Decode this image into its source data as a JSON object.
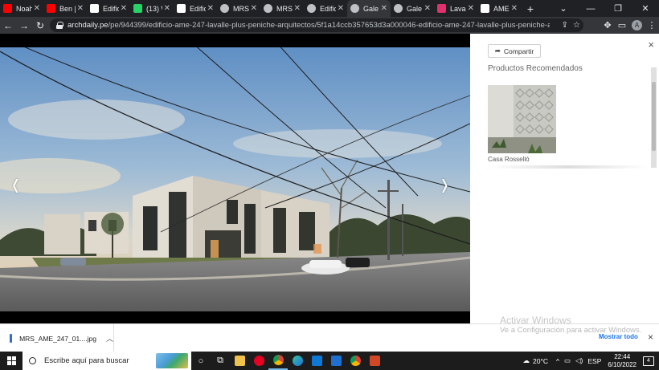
{
  "tabs": [
    {
      "title": "Noah",
      "icon": "youtube-icon",
      "color": "#ff0000"
    },
    {
      "title": "Ben |",
      "icon": "youtube-icon",
      "color": "#ff0000"
    },
    {
      "title": "Edific",
      "icon": "archdaily-icon",
      "color": "#ffffff"
    },
    {
      "title": "(13) W",
      "icon": "whatsapp-icon",
      "color": "#25d366"
    },
    {
      "title": "Edific",
      "icon": "archdaily-icon",
      "color": "#ffffff"
    },
    {
      "title": "MRS",
      "icon": "globe-icon",
      "color": "#bdc1c6"
    },
    {
      "title": "MRS",
      "icon": "globe-icon",
      "color": "#bdc1c6"
    },
    {
      "title": "Edific",
      "icon": "loading-icon",
      "color": "#bdc1c6"
    },
    {
      "title": "Gale",
      "icon": "globe-icon",
      "color": "#bdc1c6",
      "active": true
    },
    {
      "title": "Gale",
      "icon": "globe-icon",
      "color": "#bdc1c6"
    },
    {
      "title": "Lava",
      "icon": "instagram-icon",
      "color": "#e1306c"
    },
    {
      "title": "AME",
      "icon": "archdaily-icon",
      "color": "#ffffff"
    }
  ],
  "browser": {
    "url_host": "archdaily.pe",
    "url_path": "/pe/944399/edificio-ame-247-lavalle-plus-peniche-arquitectos/5f1a14ccb357653d3a000046-edificio-ame-247-lavalle-plus-peniche-arquitectos-foto?n...",
    "avatar_letter": "A"
  },
  "viewer": {
    "prev_label": "‹",
    "next_label": "›"
  },
  "sidebar": {
    "share_label": "Compartir",
    "recommended_title": "Productos Recomendados",
    "product_name": "Casa Rosselló",
    "close_label": "×"
  },
  "activation": {
    "line1": "Activar Windows",
    "line2": "Ve a Configuración para activar Windows."
  },
  "downloads": {
    "file_name": "MRS_AME_247_01....jpg",
    "show_all": "Mostrar todo",
    "close_label": "×"
  },
  "taskbar": {
    "search_placeholder": "Escribe aquí para buscar",
    "temperature": "20°C",
    "language": "ESP",
    "time": "22:44",
    "date": "6/10/2022",
    "notification_count": "4"
  },
  "colors": {
    "browser_dark": "#202124",
    "toolbar": "#35363a",
    "link_blue": "#1a73e8"
  }
}
